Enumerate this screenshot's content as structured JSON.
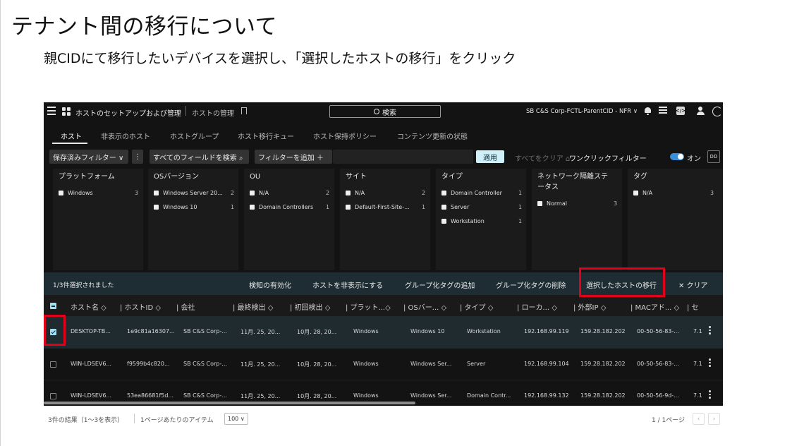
{
  "slide": {
    "title": "テナント間の移行について",
    "subtitle": "親CIDにて移行したいデバイスを選択し、「選択したホストの移行」をクリック"
  },
  "topbar": {
    "breadcrumb_1": "ホストのセットアップおよび管理",
    "breadcrumb_2": "ホストの管理",
    "search_label": "検索",
    "tenant": "SB C&S Corp-FCTL-ParentCID - NFR ∨",
    "code_icon_text": "</>"
  },
  "tabs": [
    "ホスト",
    "非表示のホスト",
    "ホストグループ",
    "ホスト移行キュー",
    "ホスト保持ポリシー",
    "コンテンツ更新の状態"
  ],
  "filterbar": {
    "saved_filters": "保存済みフィルター ∨",
    "more": "⋮",
    "search_all": "すべてのフィールドを検索 ⌕",
    "add_filter": "フィルターを追加 ＋",
    "apply": "適用",
    "clear_all": "すべてをクリア ⌂",
    "one_click": "ワンクリックフィルター",
    "toggle_label": "オン",
    "cols_icon_text": "ᴅᴅ"
  },
  "facets": [
    {
      "title": "プラットフォーム",
      "items": [
        {
          "label": "Windows",
          "count": "3"
        }
      ]
    },
    {
      "title": "OSバージョン",
      "items": [
        {
          "label": "Windows Server 20...",
          "count": "2"
        },
        {
          "label": "Windows 10",
          "count": "1"
        }
      ]
    },
    {
      "title": "OU",
      "items": [
        {
          "label": "N/A",
          "count": "2"
        },
        {
          "label": "Domain Controllers",
          "count": "1"
        }
      ]
    },
    {
      "title": "サイト",
      "items": [
        {
          "label": "N/A",
          "count": "2"
        },
        {
          "label": "Default-First-Site-...",
          "count": "1"
        }
      ]
    },
    {
      "title": "タイプ",
      "items": [
        {
          "label": "Domain Controller",
          "count": "1"
        },
        {
          "label": "Server",
          "count": "1"
        },
        {
          "label": "Workstation",
          "count": "1"
        }
      ]
    },
    {
      "title": "ネットワーク隔離ステータス",
      "title_line1": "ネットワーク隔離ステ",
      "title_line2": "ータス",
      "items": [
        {
          "label": "Normal",
          "count": "3"
        }
      ]
    },
    {
      "title": "タグ",
      "items": [
        {
          "label": "N/A",
          "count": "3"
        }
      ]
    }
  ],
  "selection_bar": {
    "status": "1/3件選択されました",
    "actions": [
      "検知の有効化",
      "ホストを非表示にする",
      "グループ化タグの追加",
      "グループ化タグの削除",
      "選択したホストの移行",
      "✕ クリア"
    ]
  },
  "table": {
    "headers": [
      "ホスト名 ◇",
      "| ホストID ◇",
      "| 会社",
      "| 最終検出 ◇",
      "| 初回検出 ◇",
      "| プラット...◇",
      "| OSバー... ◇",
      "| タイプ ◇",
      "| ローカ... ◇",
      "| 外部IP ◇",
      "| MACアド... ◇",
      "| セ"
    ],
    "rows": [
      {
        "checked": true,
        "cells": [
          "DESKTOP-TB...",
          "1e9c81a16307...",
          "SB C&S Corp-...",
          "11月. 25, 20...",
          "10月. 28, 20...",
          "Windows",
          "Windows 10",
          "Workstation",
          "192.168.99.119",
          "159.28.182.202",
          "00-50-56-83-...",
          "7.1"
        ]
      },
      {
        "checked": false,
        "cells": [
          "WIN-LDSEV6...",
          "f9599b4c820...",
          "SB C&S Corp-...",
          "11月. 25, 20...",
          "10月. 28, 20...",
          "Windows",
          "Windows Ser...",
          "Server",
          "192.168.99.104",
          "159.28.182.202",
          "00-50-56-83-...",
          "7.1"
        ]
      },
      {
        "checked": false,
        "cells": [
          "WIN-LDSEV6...",
          "53ea86681f5d...",
          "SB C&S Corp-...",
          "11月. 25, 20...",
          "10月. 28, 20...",
          "Windows",
          "Windows Ser...",
          "Domain Contr...",
          "192.168.99.132",
          "159.28.182.202",
          "00-50-56-9d-...",
          "7.1"
        ]
      }
    ]
  },
  "footer": {
    "results": "3件の結果（1～3を表示）",
    "per_page_label": "1ページあたりのアイテム",
    "per_page_value": "100 ∨",
    "page": "1 / 1ページ",
    "prev": "‹",
    "next": "›"
  }
}
